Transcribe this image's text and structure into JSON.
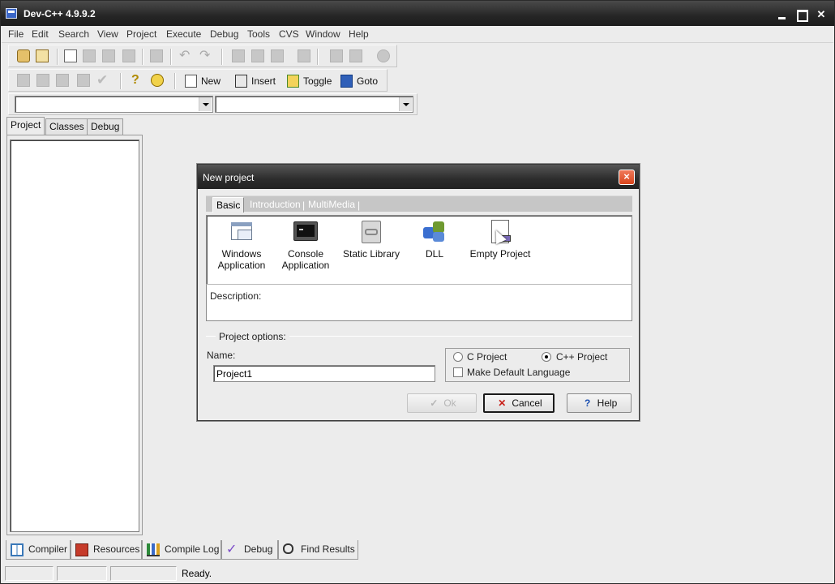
{
  "window": {
    "title": "Dev-C++ 4.9.9.2"
  },
  "menu": [
    "File",
    "Edit",
    "Search",
    "View",
    "Project",
    "Execute",
    "Debug",
    "Tools",
    "CVS",
    "Window",
    "Help"
  ],
  "toolbar2": {
    "new": "New",
    "insert": "Insert",
    "toggle": "Toggle",
    "goto": "Goto"
  },
  "left_tabs": [
    "Project",
    "Classes",
    "Debug"
  ],
  "bottom_tabs": [
    "Compiler",
    "Resources",
    "Compile Log",
    "Debug",
    "Find Results"
  ],
  "status": {
    "text": "Ready."
  },
  "dialog": {
    "title": "New project",
    "close": "×",
    "tabs": [
      "Basic",
      "Introduction",
      "MultiMedia"
    ],
    "tab_separator": "|",
    "project_types": [
      {
        "line1": "Windows",
        "line2": "Application",
        "icon": "window-app-icon"
      },
      {
        "line1": "Console",
        "line2": "Application",
        "icon": "console-icon"
      },
      {
        "line1": "Static Library",
        "line2": "",
        "icon": "library-icon"
      },
      {
        "line1": "DLL",
        "line2": "",
        "icon": "puzzle-icon"
      },
      {
        "line1": "Empty Project",
        "line2": "",
        "icon": "document-icon"
      }
    ],
    "description_label": "Description:",
    "options_label": "Project options:",
    "name_label": "Name:",
    "name_value": "Project1",
    "c_project": "C Project",
    "cpp_project": "C++ Project",
    "default_lang": "Make Default Language",
    "selected_language": "C++ Project",
    "ok": "Ok",
    "cancel": "Cancel",
    "help": "Help"
  }
}
